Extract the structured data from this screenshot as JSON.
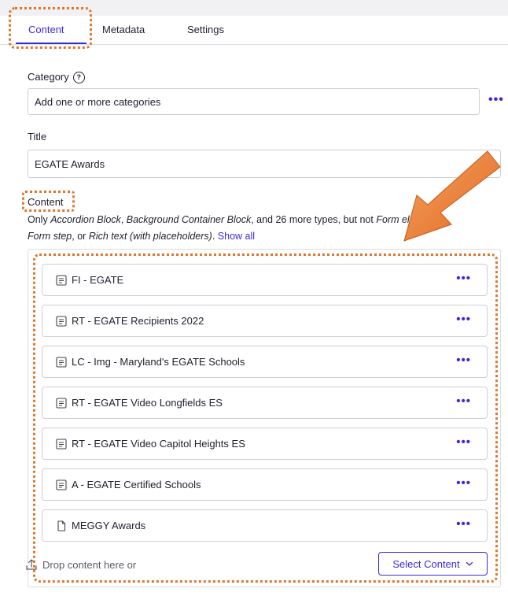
{
  "tabs": [
    {
      "label": "Content",
      "active": true
    },
    {
      "label": "Metadata",
      "active": false
    },
    {
      "label": "Settings",
      "active": false
    }
  ],
  "category": {
    "label": "Category",
    "placeholder": "Add one or more categories"
  },
  "title_field": {
    "label": "Title",
    "value": "EGATE Awards"
  },
  "content_field": {
    "label": "Content",
    "desc_prefix": "Only ",
    "desc_type1": "Accordion Block",
    "desc_sep1": ", ",
    "desc_type2": "Background Container Block",
    "desc_mid": ", and 26 more types, but not ",
    "desc_type3": "Form elements",
    "desc_sep2": ", ",
    "desc_type4": "Form step",
    "desc_sep3": ", or ",
    "desc_type5": "Rich text (with placeholders)",
    "desc_end": ". ",
    "show_all": "Show all"
  },
  "items": [
    {
      "name": "FI - EGATE",
      "icon": "block-icon"
    },
    {
      "name": "RT - EGATE Recipients 2022",
      "icon": "block-icon"
    },
    {
      "name": "LC - Img - Maryland's EGATE Schools",
      "icon": "block-icon"
    },
    {
      "name": "RT - EGATE Video Longfields ES",
      "icon": "block-icon"
    },
    {
      "name": "RT - EGATE Video Capitol Heights ES",
      "icon": "block-icon"
    },
    {
      "name": "A - EGATE Certified Schools",
      "icon": "block-icon"
    },
    {
      "name": "MEGGY Awards",
      "icon": "page-icon"
    }
  ],
  "more_glyph": "•••",
  "drop_text": "Drop content here or",
  "select_button": "Select Content",
  "colors": {
    "accent": "#3d2bd6",
    "annotation": "#e0762b"
  }
}
